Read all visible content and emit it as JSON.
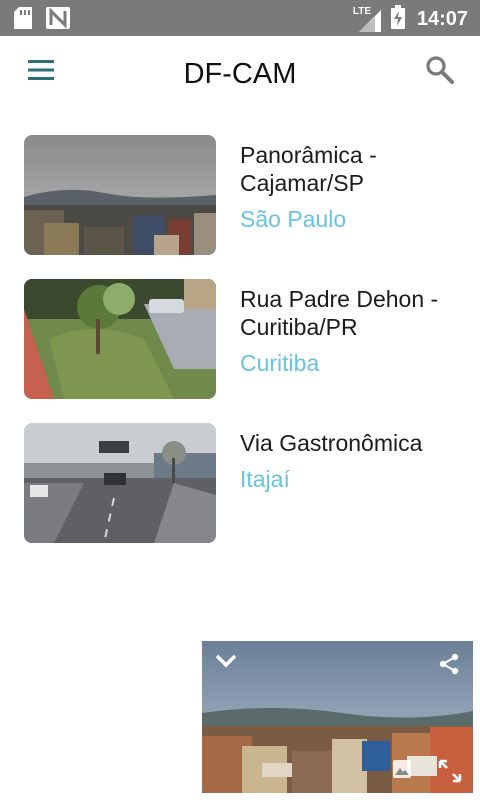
{
  "status_bar": {
    "time": "14:07",
    "network_label": "LTE",
    "icons": [
      "sd-card-icon",
      "n-notification-icon",
      "lte-signal-icon",
      "battery-charging-icon"
    ]
  },
  "app_bar": {
    "title": "DF-CAM",
    "menu_icon": "hamburger-menu-icon",
    "search_icon": "search-icon",
    "accent_color": "#2c6e7a"
  },
  "cameras": [
    {
      "name": "Panorâmica - Cajamar/SP",
      "city": "São Paulo"
    },
    {
      "name": "Rua Padre Dehon - Curitiba/PR",
      "city": "Curitiba"
    },
    {
      "name": "Via Gastronômica",
      "city": "Itajaí"
    }
  ],
  "mini_player": {
    "controls": [
      "collapse-chevron-icon",
      "share-icon",
      "snapshot-icon",
      "fullscreen-icon"
    ]
  },
  "colors": {
    "status_bar": "#7a7a7a",
    "city_text": "#67c3e0",
    "title_text": "#111111"
  }
}
